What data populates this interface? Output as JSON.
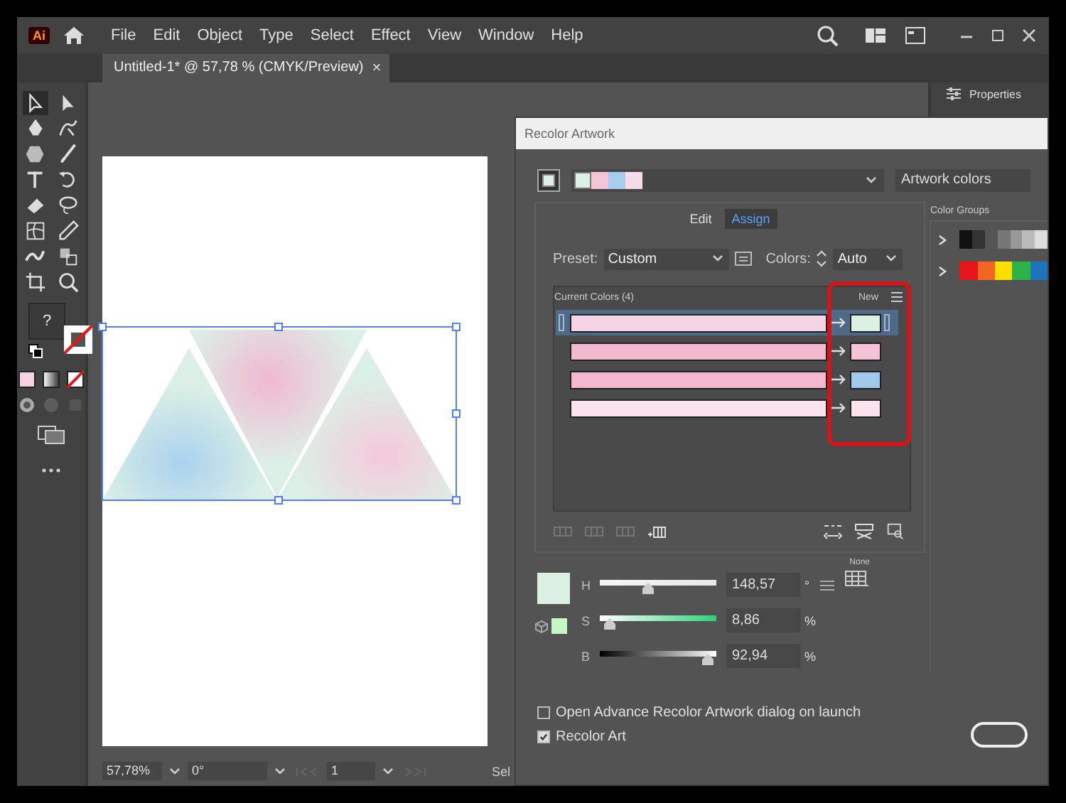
{
  "app": {
    "logo": "Ai",
    "menu": [
      "File",
      "Edit",
      "Object",
      "Type",
      "Select",
      "Effect",
      "View",
      "Window",
      "Help"
    ]
  },
  "document_tab": {
    "title": "Untitled-1* @ 57,78 % (CMYK/Preview)",
    "close": "×"
  },
  "properties_panel": {
    "title": "Properties"
  },
  "toolbar": {
    "fill_label": "?"
  },
  "status_bar": {
    "zoom": "57,78%",
    "rotation": "0°",
    "artboard": "1",
    "state": "Sel"
  },
  "dialog": {
    "title": "Recolor Artwork",
    "strip_colors": [
      {
        "color": "#f5c4d8"
      },
      {
        "color": "#a8cdee"
      },
      {
        "color": "#f7dbe8"
      }
    ],
    "color_source": "Artwork colors",
    "tabs": [
      {
        "label": "Edit",
        "selected": false
      },
      {
        "label": "Assign",
        "selected": true
      }
    ],
    "preset_label": "Preset:",
    "preset": "Custom",
    "colors_label": "Colors:",
    "colors": "Auto",
    "current_colors_label": "Current Colors (4)",
    "new_label": "New",
    "rows": [
      {
        "current": {
          "color": "#f6d6e6"
        },
        "new": {
          "color": "#dcefe3"
        },
        "selected": true
      },
      {
        "current": {
          "color": "#f3b9d1"
        },
        "new": {
          "color": "#f5c2d7"
        },
        "selected": false
      },
      {
        "current": {
          "color": "#f3b7d0"
        },
        "new": {
          "color": "#9fc9ec"
        },
        "selected": false
      },
      {
        "current": {
          "color": "#fde3ee"
        },
        "new": {
          "color": "#fbe2ec"
        },
        "selected": false
      }
    ],
    "hsb": [
      {
        "label": "H",
        "level": 0.41,
        "value": "148,57",
        "unit": "°",
        "kind": "hue"
      },
      {
        "label": "S",
        "level": 0.09,
        "value": "8,86",
        "unit": "%",
        "kind": "saturation"
      },
      {
        "label": "B",
        "level": 0.93,
        "value": "92,94",
        "unit": "%",
        "kind": "brightness"
      }
    ],
    "none_label": "None",
    "color_groups_label": "Color Groups",
    "color_groups": [
      {
        "expanded": false,
        "colors": [
          {
            "color": "#111111"
          },
          {
            "color": "#333333"
          },
          {
            "color": "#555555"
          },
          {
            "color": "#777777"
          },
          {
            "color": "#999999"
          },
          {
            "color": "#bbbbbb"
          },
          {
            "color": "#dddddd"
          }
        ]
      },
      {
        "expanded": false,
        "colors": [
          {
            "color": "#e8141b"
          },
          {
            "color": "#f26522"
          },
          {
            "color": "#ffde00"
          },
          {
            "color": "#2db34a"
          },
          {
            "color": "#1c75bc"
          }
        ]
      }
    ],
    "options": [
      {
        "label": "Open Advance Recolor Artwork dialog on launch",
        "checked": false
      },
      {
        "label": "Recolor Art",
        "checked": true
      }
    ]
  }
}
